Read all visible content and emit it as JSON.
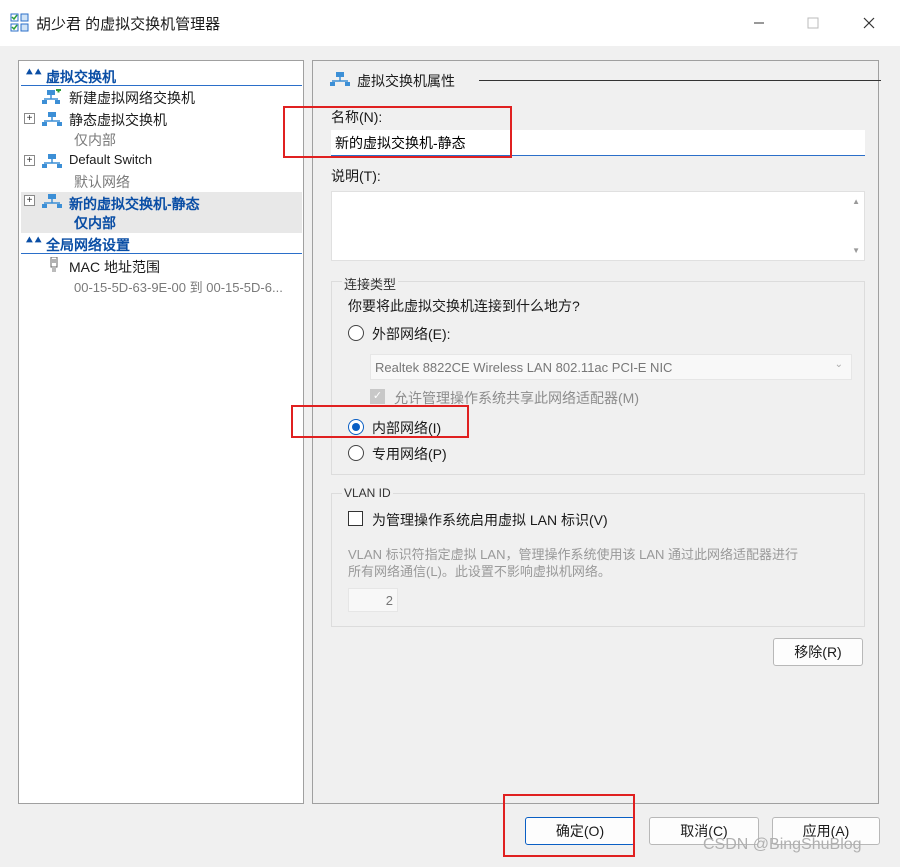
{
  "window": {
    "title": "胡少君 的虚拟交换机管理器",
    "icons": {
      "app": "switch-manager-icon",
      "min": "minimize-icon",
      "max": "maximize-icon",
      "close": "close-icon"
    }
  },
  "tree": {
    "sections": [
      {
        "label": "虚拟交换机",
        "icon": "collapse-chevron-icon"
      },
      {
        "label": "全局网络设置",
        "icon": "collapse-chevron-icon"
      }
    ],
    "items": [
      {
        "name": "新建虚拟网络交换机",
        "sub": "",
        "icon": "new-network-switch-icon"
      },
      {
        "name": "静态虚拟交换机",
        "sub": "仅内部",
        "icon": "network-switch-icon"
      },
      {
        "name": "Default Switch",
        "sub": "默认网络",
        "icon": "network-switch-icon"
      },
      {
        "name": "新的虚拟交换机-静态",
        "sub": "仅内部",
        "icon": "network-switch-icon"
      },
      {
        "name": "MAC 地址范围",
        "sub": "00-15-5D-63-9E-00 到 00-15-5D-6...",
        "icon": "mac-address-icon"
      }
    ],
    "expand_glyph": "+"
  },
  "properties": {
    "header": "虚拟交换机属性",
    "name_label": "名称(N):",
    "name_value": "新的虚拟交换机-静态",
    "desc_label": "说明(T):",
    "desc_value": "",
    "connection": {
      "group_title": "连接类型",
      "question": "你要将此虚拟交换机连接到什么地方?",
      "external_label": "外部网络(E):",
      "nic_value": "Realtek 8822CE Wireless LAN 802.11ac PCI-E NIC",
      "allow_mgmt_label": "允许管理操作系统共享此网络适配器(M)",
      "internal_label": "内部网络(I)",
      "private_label": "专用网络(P)",
      "selected": "internal"
    },
    "vlan": {
      "group_title": "VLAN ID",
      "enable_label": "为管理操作系统启用虚拟 LAN 标识(V)",
      "desc_line1": "VLAN 标识符指定虚拟 LAN，管理操作系统使用该 LAN 通过此网络适配器进行",
      "desc_line2": "所有网络通信(L)。此设置不影响虚拟机网络。",
      "vlan_value": "2"
    },
    "remove_button": "移除(R)"
  },
  "footer": {
    "ok": "确定(O)",
    "cancel": "取消(C)",
    "apply": "应用(A)"
  },
  "watermark": "CSDN @BingShuBlog",
  "colors": {
    "accent": "#0a5fc4",
    "annotation": "#e02020",
    "section_text": "#0a4ea5"
  }
}
